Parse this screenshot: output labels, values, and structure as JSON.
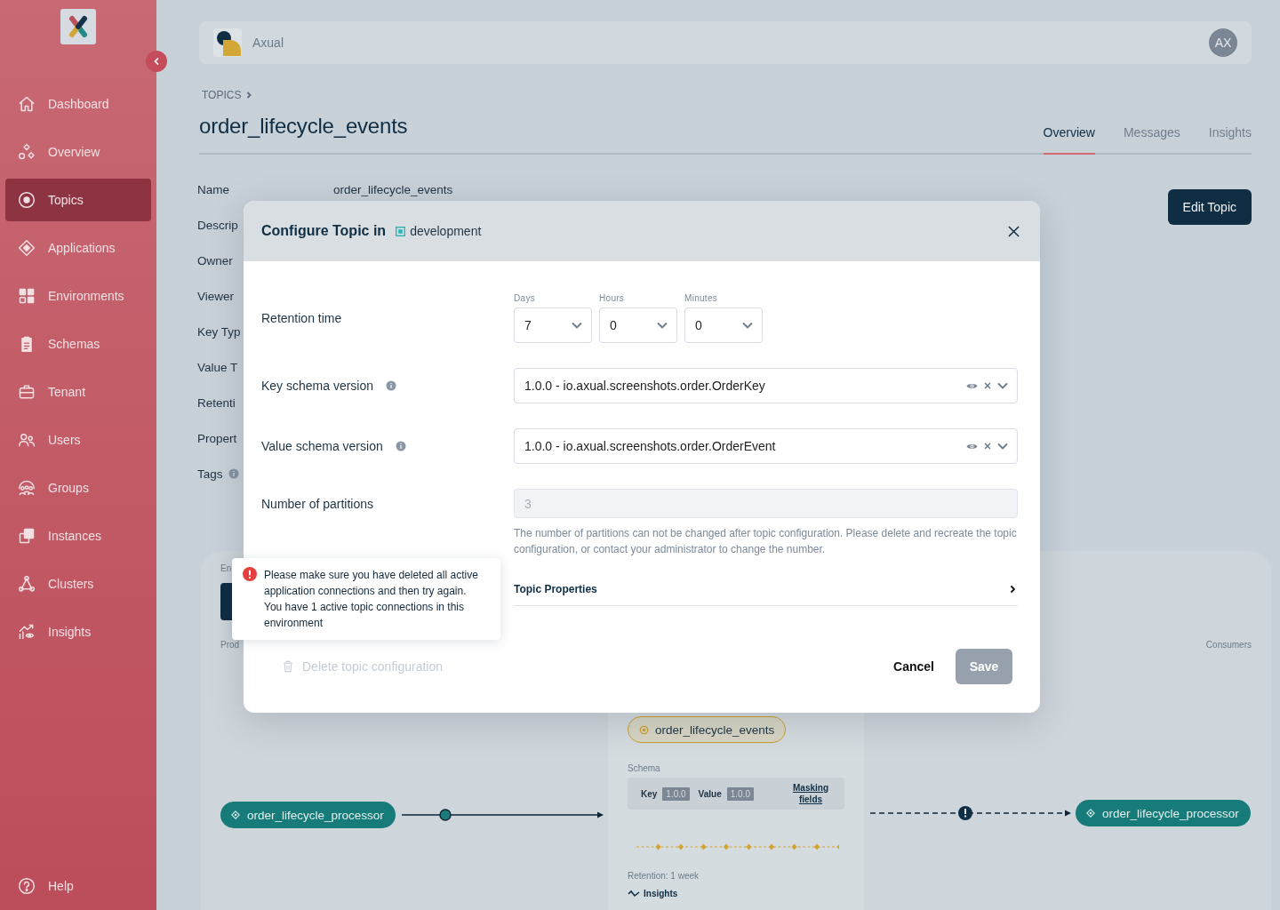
{
  "sidebar": {
    "items": [
      {
        "label": "Dashboard",
        "selected": false
      },
      {
        "label": "Overview",
        "selected": false
      },
      {
        "label": "Topics",
        "selected": true
      },
      {
        "label": "Applications",
        "selected": false
      },
      {
        "label": "Environments",
        "selected": false
      },
      {
        "label": "Schemas",
        "selected": false
      },
      {
        "label": "Tenant",
        "selected": false
      },
      {
        "label": "Users",
        "selected": false
      },
      {
        "label": "Groups",
        "selected": false
      },
      {
        "label": "Instances",
        "selected": false
      },
      {
        "label": "Clusters",
        "selected": false
      },
      {
        "label": "Insights",
        "selected": false
      }
    ],
    "help": "Help"
  },
  "header": {
    "organization": "Axual",
    "avatar": "AX"
  },
  "breadcrumb": [
    "TOPICS"
  ],
  "title": "order_lifecycle_events",
  "tabs": [
    {
      "label": "Overview",
      "selected": true
    },
    {
      "label": "Messages",
      "selected": false
    },
    {
      "label": "Insights",
      "selected": false
    }
  ],
  "edit_button": "Edit Topic",
  "details": [
    {
      "label": "Name",
      "value": "order_lifecycle_events",
      "info": false
    },
    {
      "label": "Descrip",
      "info": false
    },
    {
      "label": "Owner",
      "info": false
    },
    {
      "label": "Viewer",
      "info": false
    },
    {
      "label": "Key Typ",
      "info": false
    },
    {
      "label": "Value T",
      "info": false
    },
    {
      "label": "Retenti",
      "info": false
    },
    {
      "label": "Propert",
      "info": false
    },
    {
      "label": "Tags",
      "info": true
    }
  ],
  "flow": {
    "environment_label": "En",
    "producers_label": "Prod",
    "consumers_label": "Consumers",
    "producer": "order_lifecycle_processor",
    "topic": {
      "name": "order_lifecycle_events",
      "schema_label": "Schema",
      "key_label": "Key",
      "key_version": "1.0.0",
      "value_label": "Value",
      "value_version": "1.0.0",
      "masking_link": "Masking fields",
      "retention": "Retention: 1 week",
      "insights_link": "Insights"
    },
    "consumer": "order_lifecycle_processor"
  },
  "dialog": {
    "title": "Configure Topic in",
    "environment": "development",
    "fields": [
      {
        "kind": "duration",
        "label": "Retention time",
        "info": false,
        "units": [
          {
            "label": "Days",
            "value": "7"
          },
          {
            "label": "Hours",
            "value": "0"
          },
          {
            "label": "Minutes",
            "value": "0"
          }
        ]
      },
      {
        "kind": "select",
        "label": "Key schema version",
        "info": true,
        "value": "1.0.0 - io.axual.screenshots.order.OrderKey"
      },
      {
        "kind": "select",
        "label": "Value schema version",
        "info": true,
        "value": "1.0.0 - io.axual.screenshots.order.OrderEvent"
      },
      {
        "kind": "number",
        "label": "Number of partitions",
        "info": false,
        "value": "3",
        "disabled": true,
        "help": "The number of partitions can not be changed after topic configuration. Please delete and recreate the topic configuration, or contact your administrator to change the number."
      }
    ],
    "topic_properties": {
      "label": "Topic Properties",
      "expanded": false
    },
    "tooltip": "Please make sure you have deleted all active application connections and then try again. You have 1 active topic connections in this environment",
    "delete_button": {
      "label": "Delete topic configuration",
      "disabled": true
    },
    "cancel_button": "Cancel",
    "save_button": {
      "label": "Save",
      "disabled": true
    }
  }
}
